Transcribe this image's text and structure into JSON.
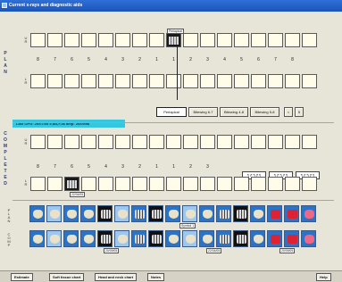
{
  "window": {
    "title": "Current x-rays and diagnostic aids"
  },
  "plan": {
    "label_letters": [
      "P",
      "L",
      "A",
      "N"
    ],
    "upper_label": [
      "U",
      "R"
    ],
    "lower_label": [
      "L",
      "R"
    ],
    "upper_image_tag": "Periapical",
    "tooth_numbers": [
      "8",
      "7",
      "6",
      "5",
      "4",
      "3",
      "2",
      "1",
      "1",
      "2",
      "3",
      "4",
      "5",
      "6",
      "7",
      "8"
    ]
  },
  "status": {
    "text": "Last OPG: 26/07/05  5,M4,F,46 amp: 26/09/98"
  },
  "toolbar": {
    "periapical": "Periapical",
    "bitewing_67": "Bitewing 6-7",
    "bitewing_48": "Bitewing 4-8",
    "bitewing_58": "Bitewing 5-8",
    "prev": "<",
    "page": "5"
  },
  "completed": {
    "label_letters": [
      "C",
      "O",
      "M",
      "P",
      "L",
      "E",
      "T",
      "E",
      "D"
    ],
    "upper_label": [
      "U",
      "R"
    ],
    "lower_label": [
      "L",
      "R"
    ],
    "tooth_numbers": [
      "8",
      "7",
      "6",
      "5",
      "4",
      "3",
      "2",
      "1",
      "1",
      "2",
      "3"
    ],
    "lower_image_tag": "22/04/05",
    "sign_placeholders": [
      "↰↱↰↱↰",
      "↰↱↰↱↰",
      "↰↱↰↱↰"
    ]
  },
  "procedures": {
    "plan_label": [
      "P",
      "L",
      "A",
      "N"
    ],
    "comp_label": [
      "C",
      "O",
      "M",
      "P"
    ],
    "plan_tag": "Symbol 1",
    "comp_tags": [
      "20/09/05",
      "22/04/05",
      "20/09/05"
    ]
  },
  "bottom": {
    "estimate": "Estimate",
    "soft_tissue": "Soft tissue chart",
    "head_neck": "Head and neck chart",
    "notes": "Notes",
    "help": "Help"
  }
}
